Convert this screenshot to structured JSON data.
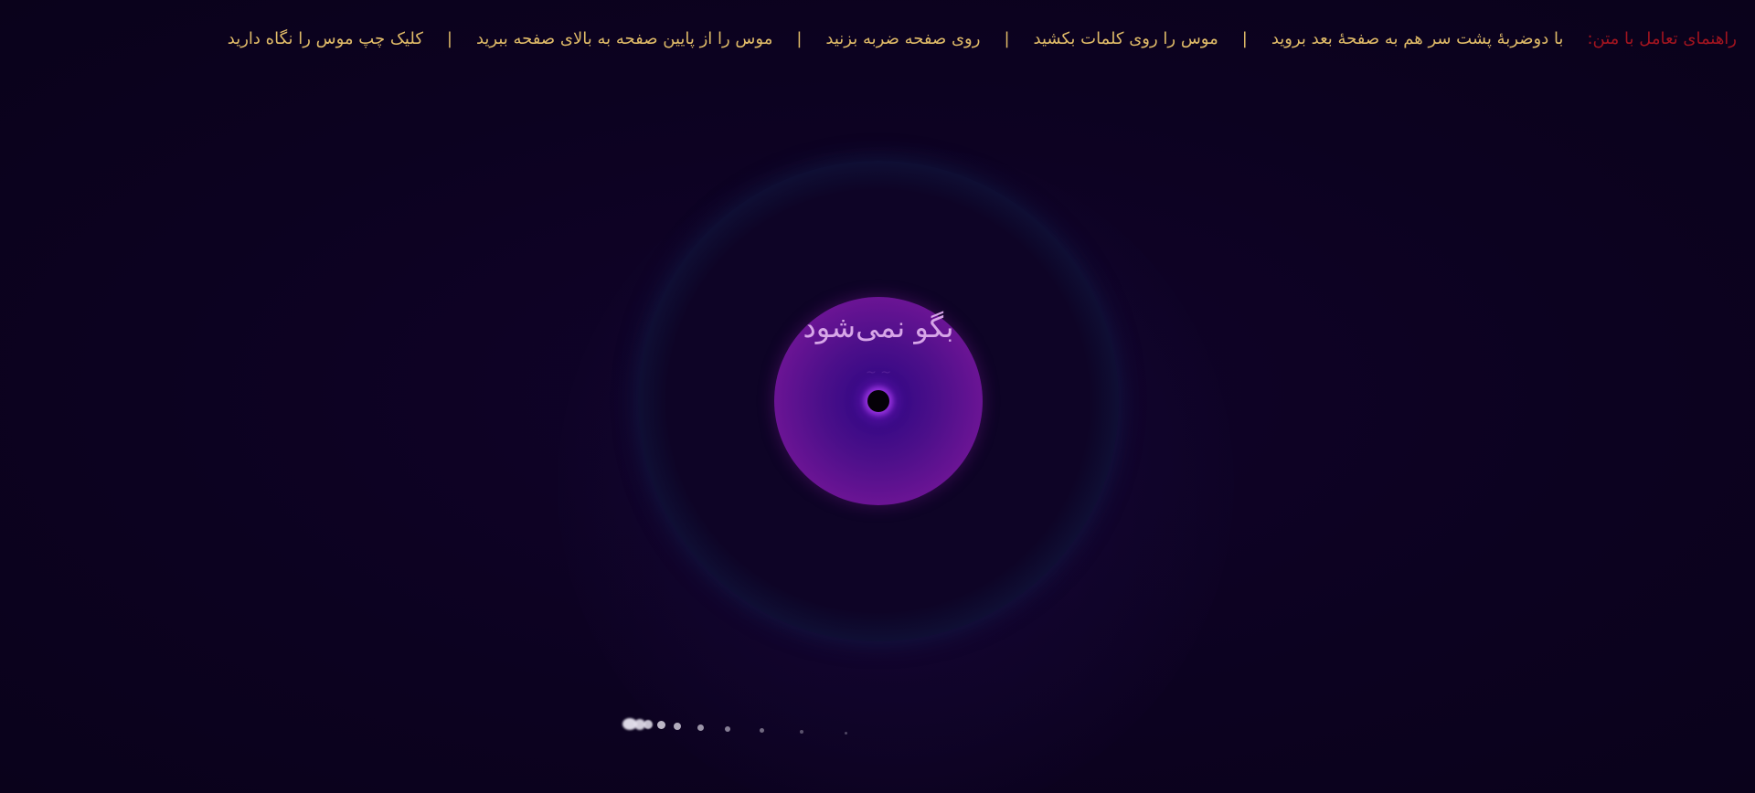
{
  "help_bar": {
    "title": "راهنمای تعامل با متن:",
    "items": [
      "با دوضربهٔ پشت سر هم به صفحهٔ بعد بروید",
      "موس را روی کلمات بکشید",
      "روی صفحه ضربه بزنید",
      "موس را از پایین صفحه به بالای صفحه ببرید",
      "کلیک چپ موس را نگاه دارید"
    ],
    "separator": "|"
  },
  "center": {
    "word": "بگو نمی‌شود"
  },
  "colors": {
    "background": "#0c0220",
    "help_title": "#a3141f",
    "help_text": "#e0bb68",
    "outer_ring": "#10384e",
    "inner_disc": "#7a1a9c",
    "word": "#d7a6e8",
    "trail": "#e8e4f0"
  }
}
